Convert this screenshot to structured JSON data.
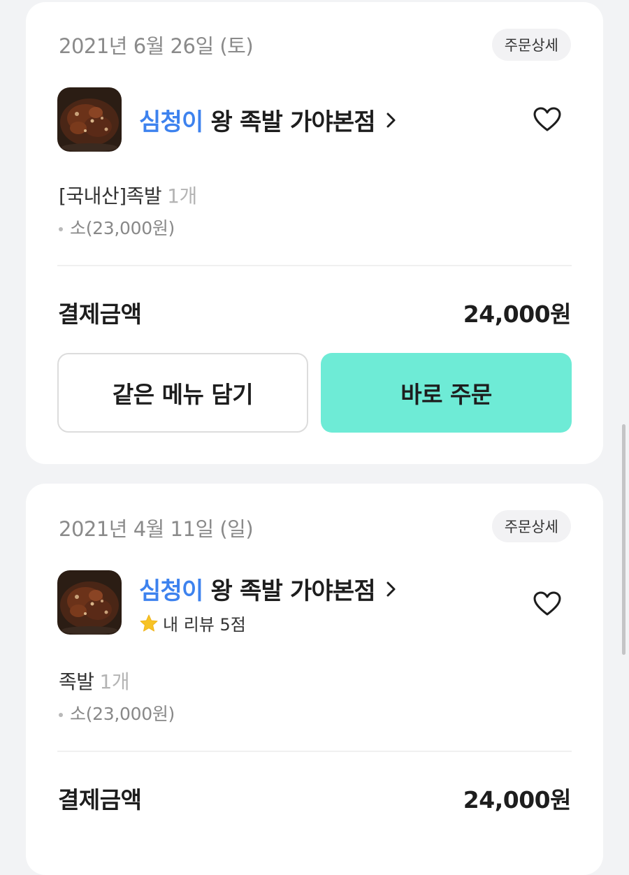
{
  "orders": [
    {
      "date": "2021년 6월 26일 (토)",
      "detail_label": "주문상세",
      "store_brand": "심청이",
      "store_name": "왕 족발 가야본점",
      "item_name": "[국내산]족발",
      "item_qty": "1개",
      "item_option": "소(23,000원)",
      "pay_label": "결제금액",
      "pay_amount": "24,000원",
      "reorder_label": "같은 메뉴 담기",
      "order_now_label": "바로 주문"
    },
    {
      "date": "2021년 4월 11일 (일)",
      "detail_label": "주문상세",
      "store_brand": "심청이",
      "store_name": "왕 족발 가야본점",
      "review_text": "내 리뷰 5점",
      "item_name": "족발",
      "item_qty": "1개",
      "item_option": "소(23,000원)",
      "pay_label": "결제금액",
      "pay_amount": "24,000원"
    }
  ],
  "icons": {
    "heart": "heart-icon",
    "chevron": "chevron-right-icon",
    "star": "star-icon"
  },
  "colors": {
    "brand_blue": "#3d82ee",
    "primary_button": "#6eebd6",
    "star": "#f7c325"
  }
}
